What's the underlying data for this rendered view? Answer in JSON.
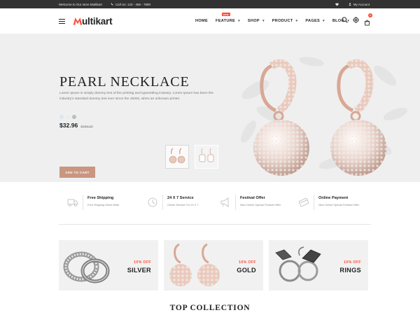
{
  "topbar": {
    "welcome": "Welcome to Our store Multikart",
    "phone": "Call Us: 123 - 456 - 7890",
    "account": "My Account",
    "icons": [
      "phone-icon",
      "heart-icon",
      "user-icon"
    ]
  },
  "header": {
    "logo_text": "ultikart",
    "nav": [
      {
        "label": "HOME",
        "caret": false,
        "badge": ""
      },
      {
        "label": "FEATURE",
        "caret": true,
        "badge": "new"
      },
      {
        "label": "SHOP",
        "caret": true,
        "badge": ""
      },
      {
        "label": "PRODUCT",
        "caret": true,
        "badge": ""
      },
      {
        "label": "PAGES",
        "caret": true,
        "badge": ""
      },
      {
        "label": "BLOG",
        "caret": true,
        "badge": ""
      }
    ],
    "cart_count": "0",
    "icons": [
      "search-icon",
      "settings-icon",
      "cart-icon"
    ]
  },
  "hero": {
    "title": "PEARL NECKLACE",
    "description": "Lorem Ipsum is simply dummy text of the printing and typesetting industry. Lorem Ipsum has been the industry's standard dummy text ever since the 1500s, when an unknown printer",
    "swatches": [
      "#d9e7f2",
      "#e4eef5",
      "#bdbdbd"
    ],
    "price_now": "$32.96",
    "price_old": "$459.00",
    "button": "ADD TO CART"
  },
  "services": [
    {
      "title": "Free Shipping",
      "sub": "Free Shipping World Wide",
      "icon": "truck-icon"
    },
    {
      "title": "24 X 7 Service",
      "sub": "Online Service For 24 X 7",
      "icon": "clock-icon"
    },
    {
      "title": "Festival Offer",
      "sub": "New Online Special Festival Offer",
      "icon": "megaphone-icon"
    },
    {
      "title": "Online Payment",
      "sub": "New Online Special Festival Offer",
      "icon": "card-icon"
    }
  ],
  "categories": [
    {
      "off": "10% OFF",
      "name": "SILVER"
    },
    {
      "off": "10% OFF",
      "name": "GOLD"
    },
    {
      "off": "10% OFF",
      "name": "RINGS"
    }
  ],
  "section_title": "TOP COLLECTION",
  "colors": {
    "accent": "#ff4c3b",
    "button": "#c99681",
    "topbar": "#323232",
    "hero_bg": "#efefef"
  }
}
